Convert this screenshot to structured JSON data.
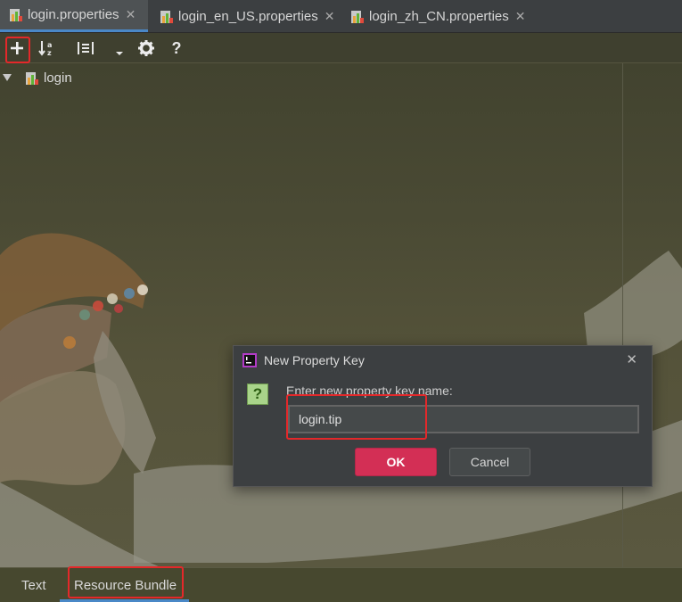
{
  "tabs": [
    {
      "label": "login.properties",
      "active": true
    },
    {
      "label": "login_en_US.properties",
      "active": false
    },
    {
      "label": "login_zh_CN.properties",
      "active": false
    }
  ],
  "toolbar": {
    "buttons": [
      "add-property",
      "sort-alphabetically",
      "group-by-prefix",
      "dropdown",
      "settings",
      "help"
    ],
    "help_label": "?"
  },
  "tree": {
    "root_label": "login"
  },
  "dialog": {
    "title": "New Property Key",
    "prompt": "Enter new property key name:",
    "input_value": "login.tip",
    "ok_label": "OK",
    "cancel_label": "Cancel",
    "icon": "question-icon"
  },
  "bottom_tabs": [
    {
      "label": "Text",
      "active": false
    },
    {
      "label": "Resource Bundle",
      "active": true
    }
  ],
  "colors": {
    "accent": "#4a88c7",
    "ok_button": "#d32f55",
    "highlight_box": "#e4282a"
  }
}
